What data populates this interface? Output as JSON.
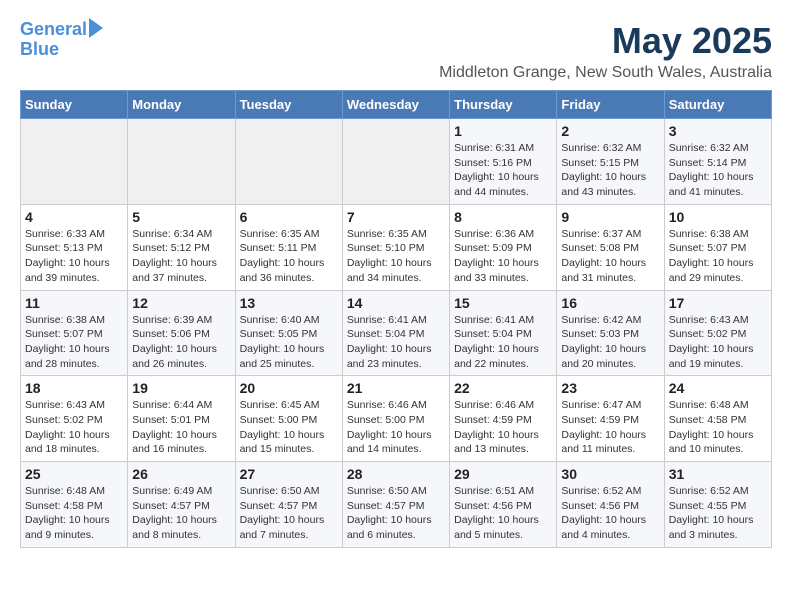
{
  "header": {
    "logo_line1": "General",
    "logo_line2": "Blue",
    "month": "May 2025",
    "location": "Middleton Grange, New South Wales, Australia"
  },
  "days_of_week": [
    "Sunday",
    "Monday",
    "Tuesday",
    "Wednesday",
    "Thursday",
    "Friday",
    "Saturday"
  ],
  "weeks": [
    [
      {
        "day": "",
        "info": ""
      },
      {
        "day": "",
        "info": ""
      },
      {
        "day": "",
        "info": ""
      },
      {
        "day": "",
        "info": ""
      },
      {
        "day": "1",
        "info": "Sunrise: 6:31 AM\nSunset: 5:16 PM\nDaylight: 10 hours\nand 44 minutes."
      },
      {
        "day": "2",
        "info": "Sunrise: 6:32 AM\nSunset: 5:15 PM\nDaylight: 10 hours\nand 43 minutes."
      },
      {
        "day": "3",
        "info": "Sunrise: 6:32 AM\nSunset: 5:14 PM\nDaylight: 10 hours\nand 41 minutes."
      }
    ],
    [
      {
        "day": "4",
        "info": "Sunrise: 6:33 AM\nSunset: 5:13 PM\nDaylight: 10 hours\nand 39 minutes."
      },
      {
        "day": "5",
        "info": "Sunrise: 6:34 AM\nSunset: 5:12 PM\nDaylight: 10 hours\nand 37 minutes."
      },
      {
        "day": "6",
        "info": "Sunrise: 6:35 AM\nSunset: 5:11 PM\nDaylight: 10 hours\nand 36 minutes."
      },
      {
        "day": "7",
        "info": "Sunrise: 6:35 AM\nSunset: 5:10 PM\nDaylight: 10 hours\nand 34 minutes."
      },
      {
        "day": "8",
        "info": "Sunrise: 6:36 AM\nSunset: 5:09 PM\nDaylight: 10 hours\nand 33 minutes."
      },
      {
        "day": "9",
        "info": "Sunrise: 6:37 AM\nSunset: 5:08 PM\nDaylight: 10 hours\nand 31 minutes."
      },
      {
        "day": "10",
        "info": "Sunrise: 6:38 AM\nSunset: 5:07 PM\nDaylight: 10 hours\nand 29 minutes."
      }
    ],
    [
      {
        "day": "11",
        "info": "Sunrise: 6:38 AM\nSunset: 5:07 PM\nDaylight: 10 hours\nand 28 minutes."
      },
      {
        "day": "12",
        "info": "Sunrise: 6:39 AM\nSunset: 5:06 PM\nDaylight: 10 hours\nand 26 minutes."
      },
      {
        "day": "13",
        "info": "Sunrise: 6:40 AM\nSunset: 5:05 PM\nDaylight: 10 hours\nand 25 minutes."
      },
      {
        "day": "14",
        "info": "Sunrise: 6:41 AM\nSunset: 5:04 PM\nDaylight: 10 hours\nand 23 minutes."
      },
      {
        "day": "15",
        "info": "Sunrise: 6:41 AM\nSunset: 5:04 PM\nDaylight: 10 hours\nand 22 minutes."
      },
      {
        "day": "16",
        "info": "Sunrise: 6:42 AM\nSunset: 5:03 PM\nDaylight: 10 hours\nand 20 minutes."
      },
      {
        "day": "17",
        "info": "Sunrise: 6:43 AM\nSunset: 5:02 PM\nDaylight: 10 hours\nand 19 minutes."
      }
    ],
    [
      {
        "day": "18",
        "info": "Sunrise: 6:43 AM\nSunset: 5:02 PM\nDaylight: 10 hours\nand 18 minutes."
      },
      {
        "day": "19",
        "info": "Sunrise: 6:44 AM\nSunset: 5:01 PM\nDaylight: 10 hours\nand 16 minutes."
      },
      {
        "day": "20",
        "info": "Sunrise: 6:45 AM\nSunset: 5:00 PM\nDaylight: 10 hours\nand 15 minutes."
      },
      {
        "day": "21",
        "info": "Sunrise: 6:46 AM\nSunset: 5:00 PM\nDaylight: 10 hours\nand 14 minutes."
      },
      {
        "day": "22",
        "info": "Sunrise: 6:46 AM\nSunset: 4:59 PM\nDaylight: 10 hours\nand 13 minutes."
      },
      {
        "day": "23",
        "info": "Sunrise: 6:47 AM\nSunset: 4:59 PM\nDaylight: 10 hours\nand 11 minutes."
      },
      {
        "day": "24",
        "info": "Sunrise: 6:48 AM\nSunset: 4:58 PM\nDaylight: 10 hours\nand 10 minutes."
      }
    ],
    [
      {
        "day": "25",
        "info": "Sunrise: 6:48 AM\nSunset: 4:58 PM\nDaylight: 10 hours\nand 9 minutes."
      },
      {
        "day": "26",
        "info": "Sunrise: 6:49 AM\nSunset: 4:57 PM\nDaylight: 10 hours\nand 8 minutes."
      },
      {
        "day": "27",
        "info": "Sunrise: 6:50 AM\nSunset: 4:57 PM\nDaylight: 10 hours\nand 7 minutes."
      },
      {
        "day": "28",
        "info": "Sunrise: 6:50 AM\nSunset: 4:57 PM\nDaylight: 10 hours\nand 6 minutes."
      },
      {
        "day": "29",
        "info": "Sunrise: 6:51 AM\nSunset: 4:56 PM\nDaylight: 10 hours\nand 5 minutes."
      },
      {
        "day": "30",
        "info": "Sunrise: 6:52 AM\nSunset: 4:56 PM\nDaylight: 10 hours\nand 4 minutes."
      },
      {
        "day": "31",
        "info": "Sunrise: 6:52 AM\nSunset: 4:55 PM\nDaylight: 10 hours\nand 3 minutes."
      }
    ]
  ]
}
